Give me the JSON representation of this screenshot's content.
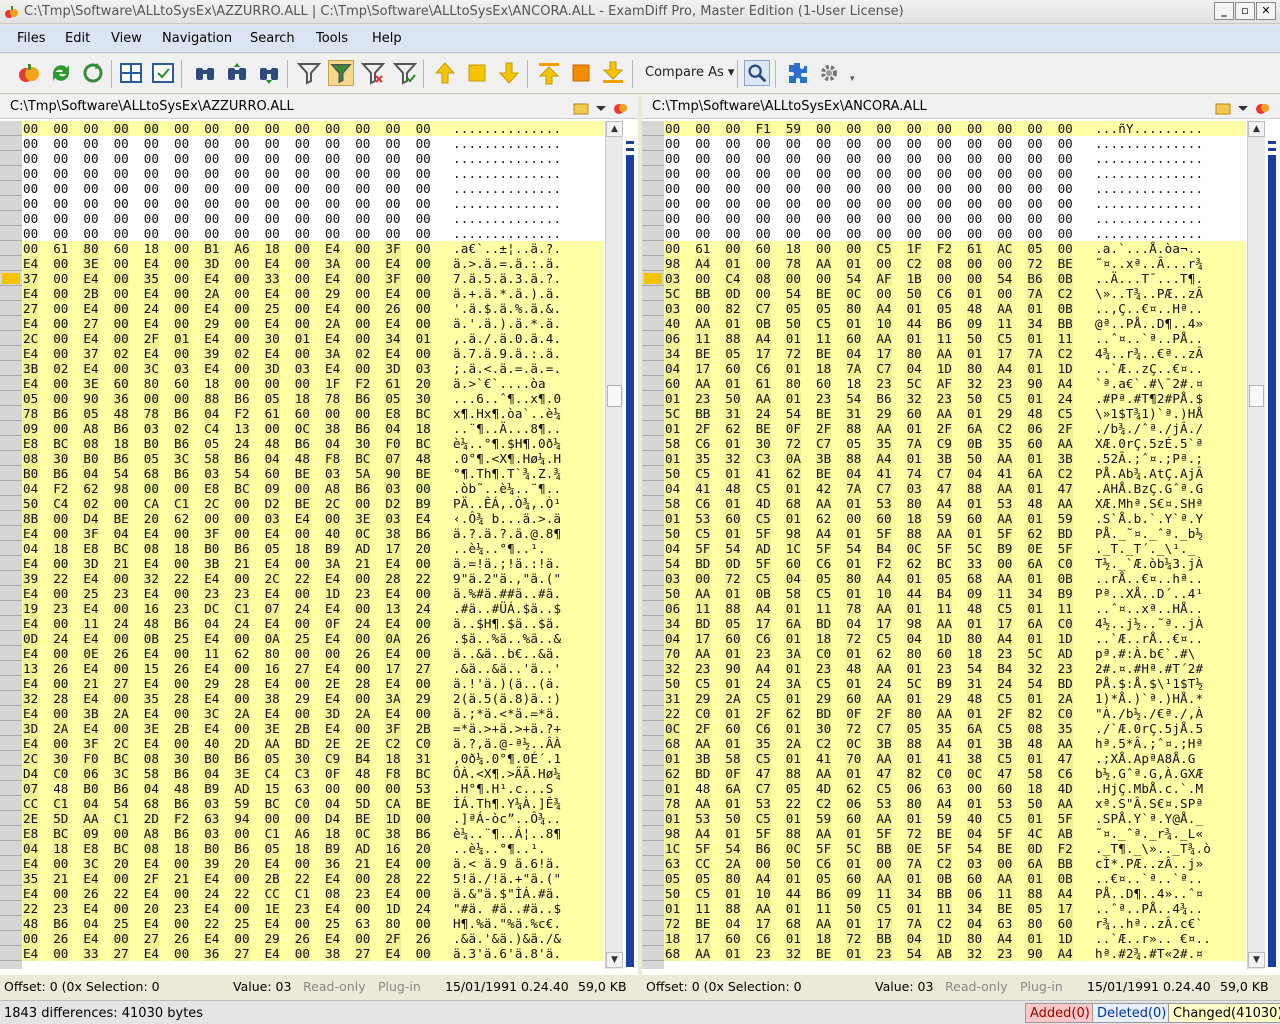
{
  "window": {
    "title": "C:\\Tmp\\Software\\ALLtoSysEx\\AZZURRO.ALL  |  C:\\Tmp\\Software\\ALLtoSysEx\\ANCORA.ALL - ExamDiff Pro, Master Edition (1-User License)"
  },
  "menu": [
    "Files",
    "Edit",
    "View",
    "Navigation",
    "Search",
    "Tools",
    "Help"
  ],
  "toolbar": {
    "compare_as": "Compare As"
  },
  "colors": {
    "changed": "#ffffa6",
    "diff_byte": "#f0f094",
    "mapbar": "#1a3e9c",
    "added": "#ffc8c8",
    "deleted": "#e8f0ff"
  },
  "left": {
    "path": "C:\\Tmp\\Software\\ALLtoSysEx\\AZZURRO.ALL",
    "status": {
      "offset": "Offset: 0 (0x Selection: 0",
      "value": "Value: 03",
      "readonly": "Read-only",
      "plugin": "Plug-in",
      "date": "15/01/1991 0.24.40",
      "size": "59,0 KB"
    },
    "rows": [
      [
        "00 00 00 00 00 00 00 00 00 00 00 00 00 00",
        ".............."
      ],
      [
        "00 00 00 00 00 00 00 00 00 00 00 00 00 00",
        ".............."
      ],
      [
        "00 00 00 00 00 00 00 00 00 00 00 00 00 00",
        ".............."
      ],
      [
        "00 00 00 00 00 00 00 00 00 00 00 00 00 00",
        ".............."
      ],
      [
        "00 00 00 00 00 00 00 00 00 00 00 00 00 00",
        ".............."
      ],
      [
        "00 00 00 00 00 00 00 00 00 00 00 00 00 00",
        ".............."
      ],
      [
        "00 00 00 00 00 00 00 00 00 00 00 00 00 00",
        ".............."
      ],
      [
        "00 00 00 00 00 00 00 00 00 00 00 00 00 00",
        ".............."
      ],
      [
        "00 61 80 60 18 00 B1 A6 18 00 E4 00 3F 00",
        ".a€`..±¦..ä.?."
      ],
      [
        "E4 00 3E 00 E4 00 3D 00 E4 00 3A 00 E4 00",
        "ä.>.ä.=.ä.:.ä."
      ],
      [
        "37 00 E4 00 35 00 E4 00 33 00 E4 00 3F 00",
        "7.ä.5.ä.3.ä.?."
      ],
      [
        "E4 00 2B 00 E4 00 2A 00 E4 00 29 00 E4 00",
        "ä.+.ä.*.ä.).ä."
      ],
      [
        "27 00 E4 00 24 00 E4 00 25 00 E4 00 26 00",
        "'.ä.$.ä.%.ä.&."
      ],
      [
        "E4 00 27 00 E4 00 29 00 E4 00 2A 00 E4 00",
        "ä.'.ä.).ä.*.ä."
      ],
      [
        "2C 00 E4 00 2F 01 E4 00 30 01 E4 00 34 01",
        ",.ä./.ä.0.ä.4."
      ],
      [
        "E4 00 37 02 E4 00 39 02 E4 00 3A 02 E4 00",
        "ä.7.ä.9.ä.:.ä."
      ],
      [
        "3B 02 E4 00 3C 03 E4 00 3D 03 E4 00 3D 03",
        ";.ä.<.ä.=.ä.=."
      ],
      [
        "E4 00 3E 60 80 60 18 00 00 00 1F F2 61 20",
        "ä.>`€`....òa "
      ],
      [
        "05 00 90 36 00 00 88 B6 05 18 78 B6 05 30",
        "...6..ˆ¶..x¶.0"
      ],
      [
        "78 B6 05 48 78 B6 04 F2 61 60 00 00 E8 BC",
        "x¶.Hx¶.òa`..è¼"
      ],
      [
        "09 00 A8 B6 03 02 C4 13 00 0C 38 B6 04 18",
        "..¨¶..Ä...8¶.."
      ],
      [
        "E8 BC 08 18 B0 B6 05 24 48 B6 04 30 F0 BC",
        "è¼..°¶.$H¶.0ð¼"
      ],
      [
        "08 30 B0 B6 05 3C 58 B6 04 48 F8 BC 07 48",
        ".0°¶.<X¶.Hø¼.H"
      ],
      [
        "B0 B6 04 54 68 B6 03 54 60 BE 03 5A 90 BE",
        "°¶.Th¶.T`¾.Z.¾"
      ],
      [
        "04 F2 62 98 00 00 E8 BC 09 00 A8 B6 03 00",
        ".òb˜..è¼..¨¶.."
      ],
      [
        "50 C4 02 00 CA C1 2C 00 D2 BE 2C 00 D2 B9",
        "PÄ..ÊÁ,.Ò¾,.Ò¹"
      ],
      [
        "8B 00 D4 BE 20 62 00 00 03 E4 00 3E 03 E4",
        "‹.Ô¾ b...ä.>.ä"
      ],
      [
        "E4 00 3F 04 E4 00 3F 00 E4 00 40 0C 38 B6",
        "ä.?.ä.?.ä.@.8¶"
      ],
      [
        "04 18 E8 BC 08 18 B0 B6 05 18 B9 AD 17 20",
        "..è¼..°¶..¹­. "
      ],
      [
        "E4 00 3D 21 E4 00 3B 21 E4 00 3A 21 E4 00",
        "ä.=!ä.;!ä.:!ä."
      ],
      [
        "39 22 E4 00 32 22 E4 00 2C 22 E4 00 28 22",
        "9\"ä.2\"ä.,\"ä.(\""
      ],
      [
        "E4 00 25 23 E4 00 23 23 E4 00 1D 23 E4 00",
        "ä.%#ä.##ä..#ä."
      ],
      [
        "19 23 E4 00 16 23 DC C1 07 24 E4 00 13 24",
        ".#ä..#ÜÁ.$ä..$"
      ],
      [
        "E4 00 11 24 48 B6 04 24 E4 00 0F 24 E4 00",
        "ä..$H¶.$ä..$ä."
      ],
      [
        "0D 24 E4 00 0B 25 E4 00 0A 25 E4 00 0A 26",
        ".$ä..%ä..%ä..&"
      ],
      [
        "E4 00 0E 26 E4 00 11 62 80 00 00 26 E4 00",
        "ä..&ä..b€..&ä."
      ],
      [
        "13 26 E4 00 15 26 E4 00 16 27 E4 00 17 27",
        ".&ä..&ä..'ä..'"
      ],
      [
        "E4 00 21 27 E4 00 29 28 E4 00 2E 28 E4 00",
        "ä.!'ä.)(ä..(ä."
      ],
      [
        "32 28 E4 00 35 28 E4 00 38 29 E4 00 3A 29",
        "2(ä.5(ä.8)ä.:)"
      ],
      [
        "E4 00 3B 2A E4 00 3C 2A E4 00 3D 2A E4 00",
        "ä.;*ä.<*ä.=*ä."
      ],
      [
        "3D 2A E4 00 3E 2B E4 00 3E 2B E4 00 3F 2B",
        "=*ä.>+ä.>+ä.?+"
      ],
      [
        "E4 00 3F 2C E4 00 40 2D AA BD 2E 2E C2 C0",
        "ä.?,ä.@-ª½..ÂÀ"
      ],
      [
        "2C 30 F0 BC 08 30 B0 B6 05 30 C9 B4 18 31",
        ",0ð¼.0°¶.0É´.1"
      ],
      [
        "D4 C0 06 3C 58 B6 04 3E C4 C3 0F 48 F8 BC",
        "ÔÀ.<X¶.>ÄÃ.Hø¼"
      ],
      [
        "07 48 B0 B6 04 48 B9 AD 15 63 00 00 00 53",
        ".H°¶.H¹­.c...S"
      ],
      [
        "CC C1 04 54 68 B6 03 59 BC C0 04 5D CA BE",
        "ÌÁ.Th¶.Y¼À.]Ê¾"
      ],
      [
        "2E 5D AA C1 2D F2 63 94 00 00 D4 BE 1D 00",
        ".]ªÁ-òc”..Ô¾.."
      ],
      [
        "E8 BC 09 00 A8 B6 03 00 C1 A6 18 0C 38 B6",
        "è¼..¨¶..Á¦..8¶"
      ],
      [
        "04 18 E8 BC 08 18 B0 B6 05 18 B9 AD 16 20",
        "..è¼..°¶..¹­. "
      ],
      [
        "E4 00 3C 20 E4 00 39 20 E4 00 36 21 E4 00",
        "ä.< ä.9 ä.6!ä."
      ],
      [
        "35 21 E4 00 2F 21 E4 00 2B 22 E4 00 28 22",
        "5!ä./!ä.+\"ä.(\""
      ],
      [
        "E4 00 26 22 E4 00 24 22 CC C1 08 23 E4 00",
        "ä.&\"ä.$\"ÌÁ.#ä."
      ],
      [
        "22 23 E4 00 20 23 E4 00 1E 23 E4 00 1D 24",
        "\"#ä. #ä..#ä..$"
      ],
      [
        "48 B6 04 25 E4 00 22 25 E4 00 25 63 80 00",
        "H¶.%ä.\"%ä.%c€."
      ],
      [
        "00 26 E4 00 27 26 E4 00 29 26 E4 00 2F 26",
        ".&ä.'&ä.)&ä./&"
      ],
      [
        "E4 00 33 27 E4 00 36 27 E4 00 38 27 E4 00",
        "ä.3'ä.6'ä.8'ä."
      ]
    ]
  },
  "right": {
    "path": "C:\\Tmp\\Software\\ALLtoSysEx\\ANCORA.ALL",
    "status": {
      "offset": "Offset: 0 (0x Selection: 0",
      "value": "Value: 03",
      "readonly": "Read-only",
      "plugin": "Plug-in",
      "date": "15/01/1991 0.24.40",
      "size": "59,0 KB"
    },
    "rows": [
      [
        "00 00 00 F1 59 00 00 00 00 00 00 00 00 00",
        "...ñY........."
      ],
      [
        "00 00 00 00 00 00 00 00 00 00 00 00 00 00",
        ".............."
      ],
      [
        "00 00 00 00 00 00 00 00 00 00 00 00 00 00",
        ".............."
      ],
      [
        "00 00 00 00 00 00 00 00 00 00 00 00 00 00",
        ".............."
      ],
      [
        "00 00 00 00 00 00 00 00 00 00 00 00 00 00",
        ".............."
      ],
      [
        "00 00 00 00 00 00 00 00 00 00 00 00 00 00",
        ".............."
      ],
      [
        "00 00 00 00 00 00 00 00 00 00 00 00 00 00",
        ".............."
      ],
      [
        "00 00 00 00 00 00 00 00 00 00 00 00 00 00",
        ".............."
      ],
      [
        "00 61 00 60 18 00 00 C5 1F F2 61 AC 05 00",
        ".a.`...Å.òa¬.."
      ],
      [
        "98 A4 01 00 78 AA 01 00 C2 08 00 00 72 BE",
        "˜¤..xª..Â...r¾"
      ],
      [
        "03 00 C4 08 00 00 54 AF 1B 00 00 54 B6 0B",
        "..Ä...T¯...T¶."
      ],
      [
        "5C BB 0D 00 54 BE 0C 00 50 C6 01 00 7A C2",
        "\\»..T¾..PÆ..zÂ"
      ],
      [
        "03 00 82 C7 05 05 80 A4 01 05 48 AA 01 0B",
        "..‚Ç..€¤..Hª.."
      ],
      [
        "40 AA 01 0B 50 C5 01 10 44 B6 09 11 34 BB",
        "@ª..PÅ..D¶..4»"
      ],
      [
        "06 11 88 A4 01 11 60 AA 01 11 50 C5 01 11",
        "..ˆ¤..`ª..PÅ.."
      ],
      [
        "34 BE 05 17 72 BE 04 17 80 AA 01 17 7A C2",
        "4¾..r¾..€ª..zÂ"
      ],
      [
        "04 17 60 C6 01 18 7A C7 04 1D 80 A4 01 1D",
        "..`Æ..zÇ..€¤.."
      ],
      [
        "60 AA 01 61 80 60 18 23 5C AF 32 23 90 A4",
        "`ª.a€`.#\\¯2#.¤"
      ],
      [
        "01 23 50 AA 01 23 54 B6 32 23 50 C5 01 24",
        ".#Pª.#T¶2#PÅ.$"
      ],
      [
        "5C BB 31 24 54 BE 31 29 60 AA 01 29 48 C5",
        "\\»1$T¾1)`ª.)HÅ"
      ],
      [
        "01 2F 62 BE 0F 2F 88 AA 01 2F 6A C2 06 2F",
        "./b¾./ˆª./jÂ./"
      ],
      [
        "58 C6 01 30 72 C7 05 35 7A C9 0B 35 60 AA",
        "XÆ.0rÇ.5zÉ.5`ª"
      ],
      [
        "01 35 32 C3 0A 3B 88 A4 01 3B 50 AA 01 3B",
        ".52Ã.;ˆ¤.;Pª.;"
      ],
      [
        "50 C5 01 41 62 BE 04 41 74 C7 04 41 6A C2",
        "PÅ.Ab¾.AtÇ.AjÂ"
      ],
      [
        "04 41 48 C5 01 42 7A C7 03 47 88 AA 01 47",
        ".AHÅ.BzÇ.Gˆª.G"
      ],
      [
        "58 C6 01 4D 68 AA 01 53 80 A4 01 53 48 AA",
        "XÆ.Mhª.S€¤.SHª"
      ],
      [
        "01 53 60 C5 01 62 00 60 18 59 60 AA 01 59",
        ".S`Å.b.`.Y`ª.Y"
      ],
      [
        "50 C5 01 5F 98 A4 01 5F 88 AA 01 5F 62 BD",
        "PÅ._˜¤._ˆª._b½"
      ],
      [
        "04 5F 54 AD 1C 5F 54 B4 0C 5F 5C B9 0E 5F",
        "._T­._T´._\\¹._"
      ],
      [
        "54 BD 0D 5F 60 C6 01 F2 62 BC 33 00 6A C0",
        "T½._`Æ.òb¼3.jÀ"
      ],
      [
        "03 00 72 C5 04 05 80 A4 01 05 68 AA 01 0B",
        "..rÅ..€¤..hª.."
      ],
      [
        "50 AA 01 0B 58 C5 01 10 44 B4 09 11 34 B9",
        "Pª..XÅ..D´..4¹"
      ],
      [
        "06 11 88 A4 01 11 78 AA 01 11 48 C5 01 11",
        "..ˆ¤..xª..HÅ.."
      ],
      [
        "34 BD 05 17 6A BD 04 17 98 AA 01 17 6A C0",
        "4½..j½..˜ª..jÀ"
      ],
      [
        "04 17 60 C6 01 18 72 C5 04 1D 80 A4 01 1D",
        "..`Æ..rÅ..€¤.."
      ],
      [
        "70 AA 01 23 3A C0 01 62 80 60 18 23 5C AD",
        "pª.#:À.b€`.#\\­"
      ],
      [
        "32 23 90 A4 01 23 48 AA 01 23 54 B4 32 23",
        "2#.¤.#Hª.#T´2#"
      ],
      [
        "50 C5 01 24 3A C5 01 24 5C B9 31 24 54 BD",
        "PÅ.$:Å.$\\¹1$T½"
      ],
      [
        "31 29 2A C5 01 29 60 AA 01 29 48 C5 01 2A",
        "1)*Å.)`ª.)HÅ.*"
      ],
      [
        "22 C0 01 2F 62 BD 0F 2F 80 AA 01 2F 82 C0",
        "\"À./b½./€ª./‚À"
      ],
      [
        "0C 2F 60 C6 01 30 72 C7 05 35 6A C5 08 35",
        "./`Æ.0rÇ.5jÅ.5"
      ],
      [
        "68 AA 01 35 2A C2 0C 3B 88 A4 01 3B 48 AA",
        "hª.5*Â.;ˆ¤.;Hª"
      ],
      [
        "01 3B 58 C5 01 41 70 AA 01 41 38 C5 01 47",
        ".;XÅ.ApªA8Å.G"
      ],
      [
        "62 BD 0F 47 88 AA 01 47 82 C0 0C 47 58 C6",
        "b½.Gˆª.G‚À.GXÆ"
      ],
      [
        "01 48 6A C7 05 4D 62 C5 06 63 00 60 18 4D",
        ".HjÇ.MbÅ.c.`.M"
      ],
      [
        "78 AA 01 53 22 C2 06 53 80 A4 01 53 50 AA",
        "xª.S\"Â.S€¤.SPª"
      ],
      [
        "01 53 50 C5 01 59 60 AA 01 59 40 C5 01 5F",
        ".SPÅ.Y`ª.Y@Å._"
      ],
      [
        "98 A4 01 5F 88 AA 01 5F 72 BE 04 5F 4C AB",
        "˜¤._ˆª._r¾._L«"
      ],
      [
        "1C 5F 54 B6 0C 5F 5C BB 0E 5F 54 BE 0D F2",
        "._T¶._\\».._T¾.ò"
      ],
      [
        "63 CC 2A 00 50 C6 01 00 7A C2 03 00 6A BB",
        "cÌ*.PÆ..zÂ..j»"
      ],
      [
        "05 05 80 A4 01 05 60 AA 01 0B 60 AA 01 0B",
        "..€¤..`ª..`ª.."
      ],
      [
        "50 C5 01 10 44 B6 09 11 34 BB 06 11 88 A4",
        "PÅ..D¶..4»..ˆ¤"
      ],
      [
        "01 11 88 AA 01 11 50 C5 01 11 34 BE 05 17",
        "..ˆª..PÅ..4¾.."
      ],
      [
        "72 BE 04 17 68 AA 01 17 7A C2 04 63 80 60",
        "r¾..hª..zÂ.c€`"
      ],
      [
        "18 17 60 C6 01 18 72 BB 04 1D 80 A4 01 1D",
        "..`Æ..r».. €¤.."
      ],
      [
        "68 AA 01 23 32 BE 01 23 54 AB 32 23 90 A4",
        "hª.#2¾.#T«2#.¤"
      ]
    ]
  },
  "bottom": {
    "summary": "1843 differences: 41030 bytes",
    "added": "Added(0)",
    "deleted": "Deleted(0)",
    "changed": "Changed(41030)"
  }
}
